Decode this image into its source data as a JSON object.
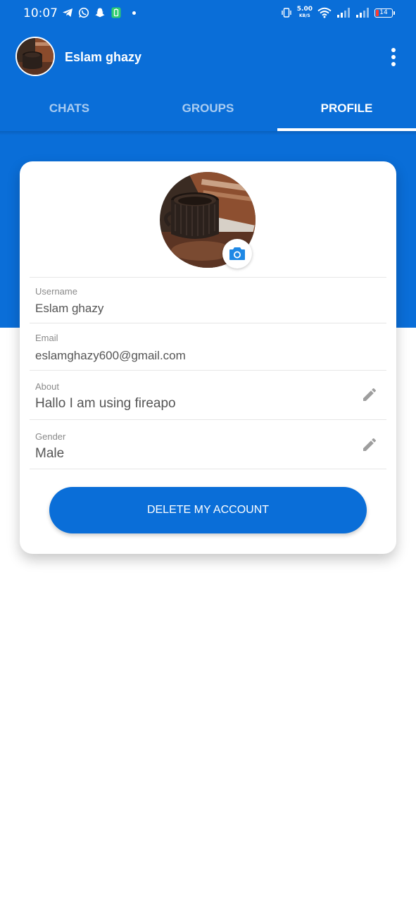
{
  "status_bar": {
    "time": "10:07",
    "speed_value": "5.00",
    "speed_unit": "KB/S",
    "battery": "14",
    "icons": [
      "telegram-icon",
      "whatsapp-icon",
      "snapchat-icon",
      "battery-saver-icon",
      "vibrate-icon",
      "wifi-icon",
      "signal-icon",
      "signal-icon",
      "battery-icon"
    ]
  },
  "app_bar": {
    "title": "Eslam ghazy",
    "menu_icon": "more-vert-icon"
  },
  "tabs": [
    {
      "label": "CHATS",
      "active": false
    },
    {
      "label": "GROUPS",
      "active": false
    },
    {
      "label": "PROFILE",
      "active": true
    }
  ],
  "profile": {
    "fields": [
      {
        "label": "Username",
        "value": "Eslam ghazy",
        "editable": false
      },
      {
        "label": "Email",
        "value": "eslamghazy600@gmail.com",
        "editable": false
      },
      {
        "label": "About",
        "value": "Hallo I am using fireapo",
        "editable": true
      },
      {
        "label": "Gender",
        "value": "Male",
        "editable": true
      }
    ],
    "delete_button": "DELETE MY ACCOUNT"
  },
  "colors": {
    "primary": "#0a6ed8",
    "accent_icon": "#1e88e5",
    "edit_icon": "#9e9e9e"
  }
}
